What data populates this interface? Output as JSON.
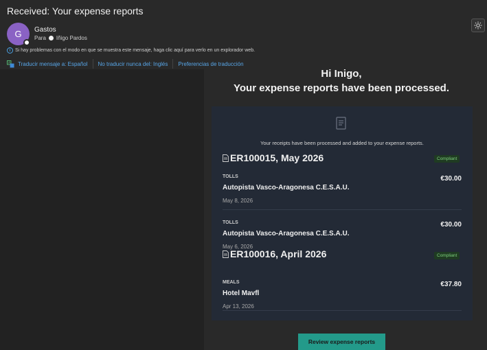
{
  "header": {
    "subject": "Received: Your expense reports",
    "avatar_initial": "G",
    "sender": "Gastos",
    "to_label": "Para",
    "recipient": "Iñigo Pardos",
    "info_text": "Si hay problemas con el modo en que se muestra este mensaje, haga clic aquí para verlo en un explorador web."
  },
  "translation": {
    "translate_link": "Traducir mensaje a: Español",
    "never_translate_link": "No traducir nunca del: Inglés",
    "preferences_link": "Preferencias de traducción"
  },
  "email": {
    "greeting_line1": "Hi Inigo,",
    "greeting_line2": "Your expense reports have been processed.",
    "intro": "Your receipts have been processed and added to your expense reports.",
    "reports": [
      {
        "id_title": "ER100015, May 2026",
        "status": "Compliant",
        "items": [
          {
            "category": "TOLLS",
            "merchant": "Autopista Vasco-Aragonesa C.E.S.A.U.",
            "date": "May 8, 2026",
            "amount": "€30.00"
          },
          {
            "category": "TOLLS",
            "merchant": "Autopista Vasco-Aragonesa C.E.S.A.U.",
            "date": "May 6, 2026",
            "amount": "€30.00"
          }
        ]
      },
      {
        "id_title": "ER100016, April 2026",
        "status": "Compliant",
        "items": [
          {
            "category": "MEALS",
            "merchant": "Hotel Mavfl",
            "date": "Apr 13, 2026",
            "amount": "€37.80"
          }
        ]
      }
    ],
    "review_button": "Review expense reports"
  },
  "colors": {
    "background": "#292929",
    "card": "#232a36",
    "accent_link": "#58a6e8",
    "button": "#239a8a",
    "avatar": "#8a62c4",
    "compliant_text": "#7fd17f"
  }
}
